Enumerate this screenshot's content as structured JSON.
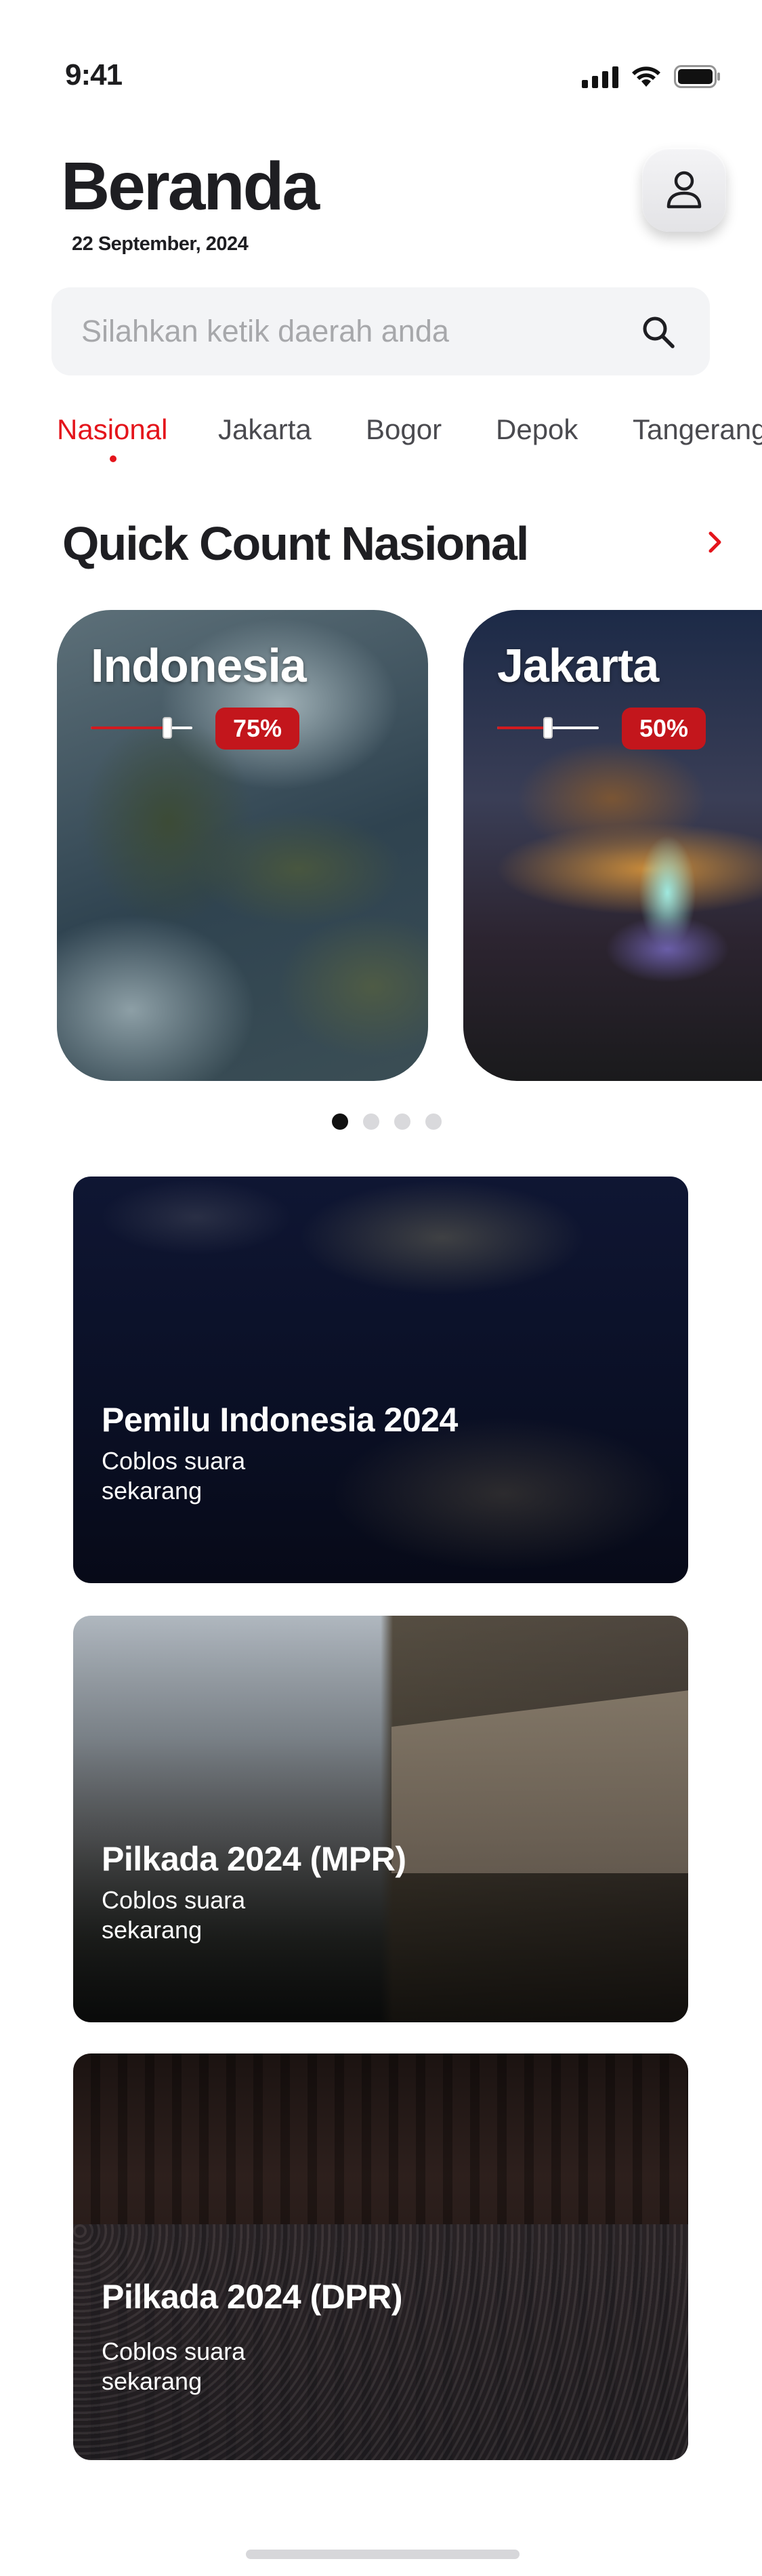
{
  "status_bar": {
    "time": "9:41",
    "icons": [
      "cellular-signal-icon",
      "wifi-icon",
      "battery-icon"
    ]
  },
  "header": {
    "title": "Beranda",
    "date": "22 September, 2024",
    "profile_icon": "user-icon"
  },
  "search": {
    "placeholder": "Silahkan ketik daerah anda",
    "value": "",
    "icon": "search-icon"
  },
  "tabs": [
    {
      "label": "Nasional",
      "active": true
    },
    {
      "label": "Jakarta",
      "active": false
    },
    {
      "label": "Bogor",
      "active": false
    },
    {
      "label": "Depok",
      "active": false
    },
    {
      "label": "Tangerang",
      "active": false
    }
  ],
  "quick_count": {
    "title": "Quick Count Nasional",
    "arrow_icon": "chevron-right-icon",
    "cards": [
      {
        "name": "Indonesia",
        "percent_label": "75%",
        "progress": 0.75
      },
      {
        "name": "Jakarta",
        "percent_label": "50%",
        "progress": 0.5
      }
    ],
    "carousel": {
      "total": 4,
      "active_index": 0
    }
  },
  "elections": [
    {
      "title": "Pemilu Indonesia 2024",
      "subtitle": "Coblos suara sekarang"
    },
    {
      "title": "Pilkada 2024 (MPR)",
      "subtitle": "Coblos suara sekarang"
    },
    {
      "title": "Pilkada 2024 (DPR)",
      "subtitle": "Coblos suara sekarang"
    }
  ],
  "colors": {
    "accent": "#e4141b",
    "badge": "#c3161c",
    "text": "#1e1e22",
    "search_bg": "#f3f4f6"
  }
}
